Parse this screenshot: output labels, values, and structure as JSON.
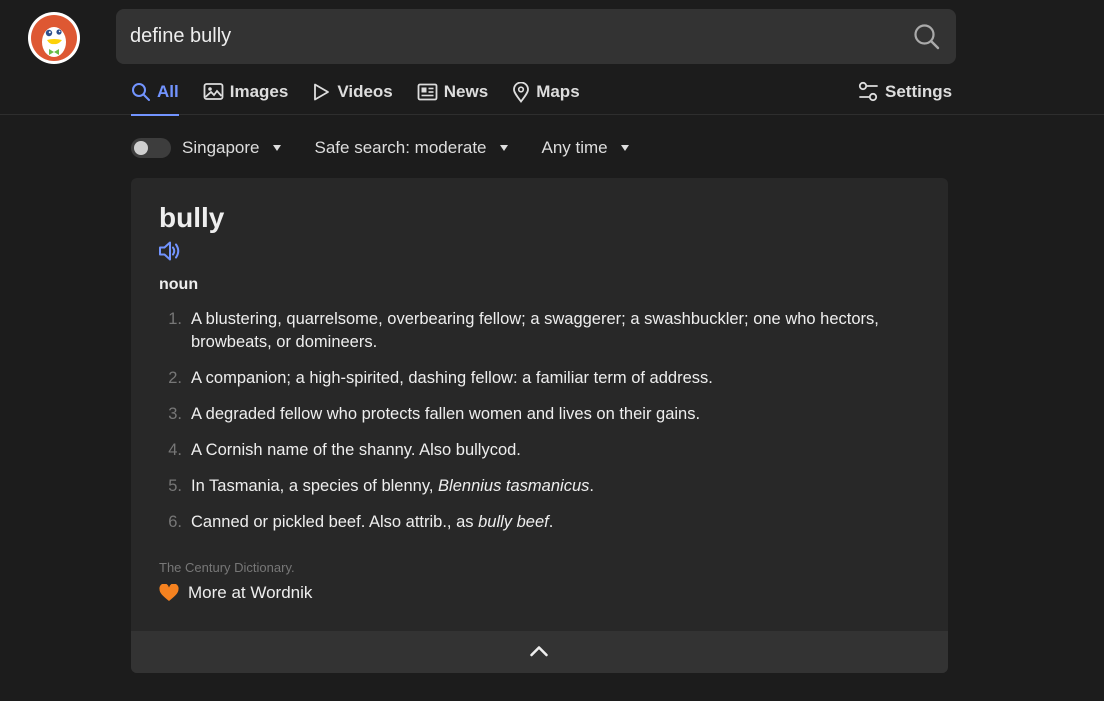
{
  "search": {
    "query": "define bully"
  },
  "nav": {
    "tabs": [
      {
        "label": "All",
        "active": true,
        "icon": "search-icon"
      },
      {
        "label": "Images",
        "active": false,
        "icon": "image-icon"
      },
      {
        "label": "Videos",
        "active": false,
        "icon": "play-icon"
      },
      {
        "label": "News",
        "active": false,
        "icon": "newspaper-icon"
      },
      {
        "label": "Maps",
        "active": false,
        "icon": "map-pin-icon"
      }
    ],
    "settings_label": "Settings"
  },
  "filters": {
    "region": "Singapore",
    "region_toggle_on": false,
    "safe_search": "Safe search: moderate",
    "time": "Any time"
  },
  "definition": {
    "word": "bully",
    "part_of_speech": "noun",
    "senses": [
      {
        "n": "1.",
        "text": "A blustering, quarrelsome, overbearing fellow; a swaggerer; a swashbuckler; one who hectors, browbeats, or domineers."
      },
      {
        "n": "2.",
        "text": "A companion; a high-spirited, dashing fellow: a familiar term of address."
      },
      {
        "n": "3.",
        "text": "A degraded fellow who protects fallen women and lives on their gains."
      },
      {
        "n": "4.",
        "text": "A Cornish name of the shanny. Also bullycod."
      },
      {
        "n": "5.",
        "text": "In Tasmania, a species of blenny, ",
        "italic": "Blennius tasmanicus",
        "after": "."
      },
      {
        "n": "6.",
        "text": "Canned or pickled beef. Also attrib., as ",
        "italic": "bully beef",
        "after": "."
      }
    ],
    "source": "The Century Dictionary.",
    "more_link": "More at Wordnik"
  },
  "colors": {
    "background": "#1c1c1c",
    "search_box": "#333333",
    "card": "#282828",
    "accent": "#7294ff",
    "logo_red": "#de5833",
    "heart": "#f58220"
  }
}
